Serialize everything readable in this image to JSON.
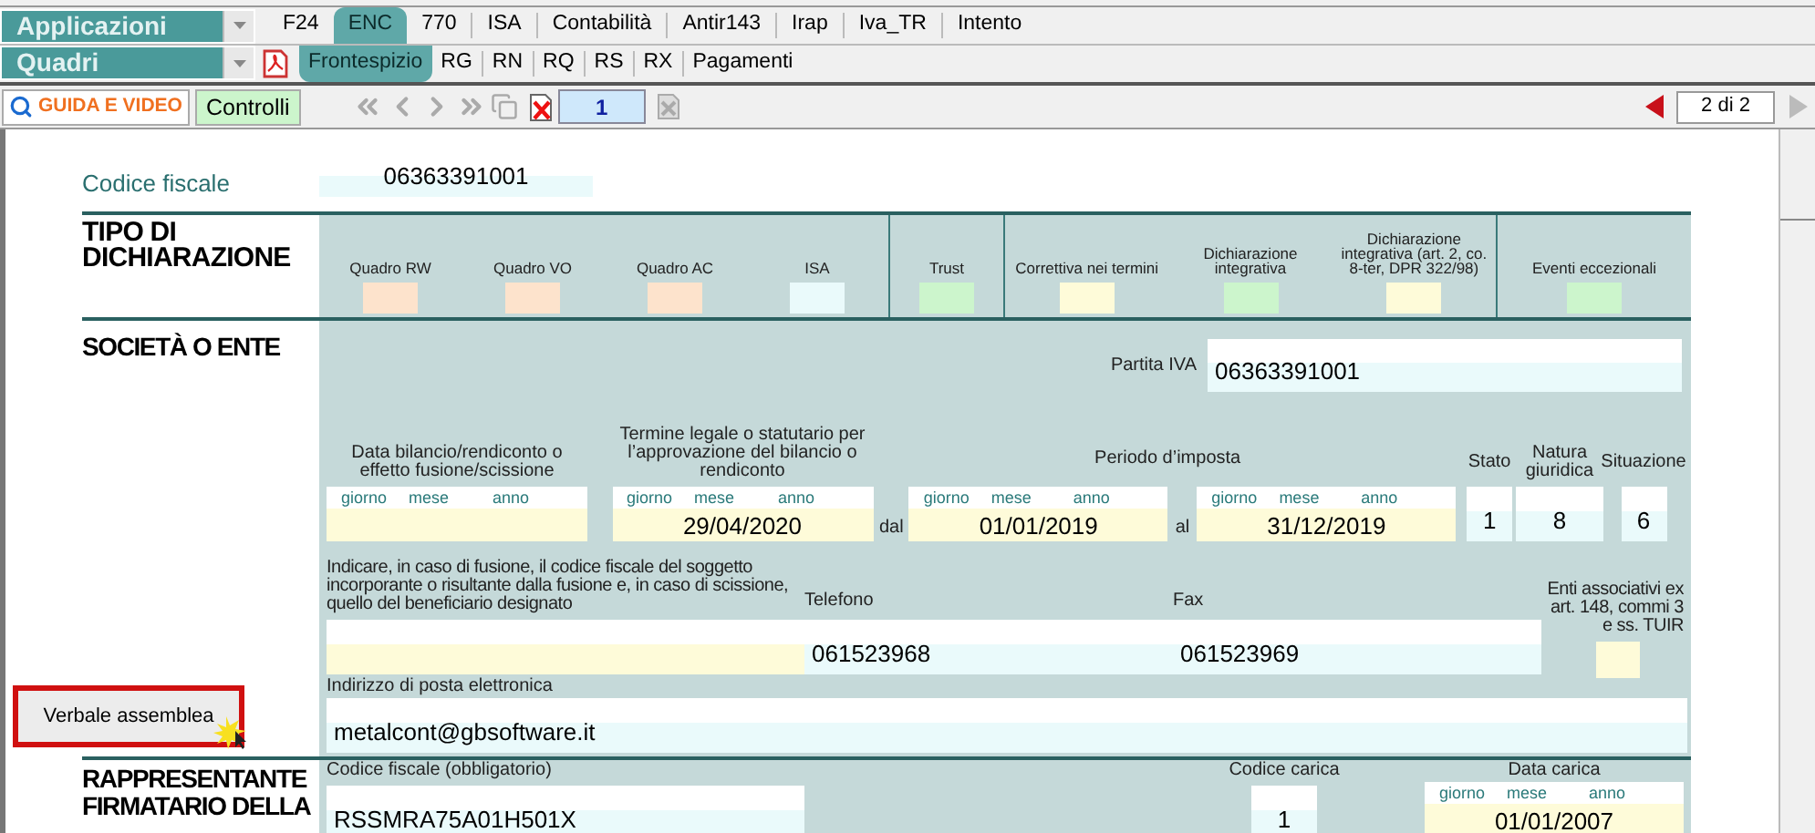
{
  "dropdowns": [
    {
      "value": "Applicazioni"
    },
    {
      "value": "Quadri"
    }
  ],
  "tabs": [
    {
      "label": "F24",
      "selected": false
    },
    {
      "label": "ENC",
      "selected": true
    },
    {
      "label": "770",
      "selected": false
    },
    {
      "label": "ISA",
      "selected": false
    },
    {
      "label": "Contabilità",
      "selected": false
    },
    {
      "label": "Antir143",
      "selected": false
    },
    {
      "label": "Irap",
      "selected": false
    },
    {
      "label": "Iva_TR",
      "selected": false
    },
    {
      "label": "Intento",
      "selected": false
    }
  ],
  "subtabs": [
    {
      "label": "Frontespizio",
      "selected": true
    },
    {
      "label": "RG",
      "selected": false
    },
    {
      "label": "RN",
      "selected": false
    },
    {
      "label": "RQ",
      "selected": false
    },
    {
      "label": "RS",
      "selected": false
    },
    {
      "label": "RX",
      "selected": false
    },
    {
      "label": "Pagamenti",
      "selected": false
    }
  ],
  "toolbar": {
    "guide_button": "GUIDA E VIDEO",
    "controls_button": "Controlli",
    "page_field": "1",
    "page_indicator": "2 di 2"
  },
  "codice_fiscale": {
    "label": "Codice fiscale",
    "value": "06363391001"
  },
  "tipo_dichiarazione": {
    "title": "TIPO DI DICHIARAZIONE",
    "groups": [
      [
        {
          "label": "Quadro RW",
          "color": "#fde3cc"
        },
        {
          "label": "Quadro VO",
          "color": "#fde3cc"
        },
        {
          "label": "Quadro AC",
          "color": "#fde3cc"
        },
        {
          "label": "ISA",
          "color": "#eafafb"
        }
      ],
      [
        {
          "label": "Trust",
          "color": "#ccf5cc"
        }
      ],
      [
        {
          "label": "Correttiva nei termini",
          "color": "#fefbd9"
        },
        {
          "label": "Dichiarazione integrativa",
          "color": "#ccf5cc"
        },
        {
          "label": "Dichiarazione integrativa (art. 2, co. 8-ter, DPR 322/98)",
          "color": "#fefbd9"
        }
      ],
      [
        {
          "label": "Eventi eccezionali",
          "color": "#ccf5cc"
        }
      ]
    ]
  },
  "societa": {
    "title": "SOCIETÀ O ENTE",
    "verbale_button": "Verbale assemblea",
    "partita_iva": {
      "label": "Partita IVA",
      "value": "06363391001"
    },
    "data_bilancio": {
      "label": "Data bilancio/rendiconto o effetto fusione/scissione",
      "parts": [
        "giorno",
        "mese",
        "anno"
      ]
    },
    "termine": {
      "label": "Termine legale o statutario per l’approvazione del bilancio o rendiconto",
      "parts": [
        "giorno",
        "mese",
        "anno"
      ],
      "value": "29/04/2020"
    },
    "periodo": {
      "label": "Periodo d’imposta",
      "from_label": "dal",
      "to_label": "al",
      "from": {
        "parts": [
          "giorno",
          "mese",
          "anno"
        ],
        "value": "01/01/2019"
      },
      "to": {
        "parts": [
          "giorno",
          "mese",
          "anno"
        ],
        "value": "31/12/2019"
      }
    },
    "stato": {
      "label": "Stato",
      "value": "1"
    },
    "natura": {
      "label": "Natura giuridica",
      "value": "8"
    },
    "situazione": {
      "label": "Situazione",
      "value": "6"
    },
    "cf_fusione": {
      "label": "Indicare, in caso di fusione, il codice fiscale del soggetto incorporante o risultante dalla fusione e, in caso di scissione, quello del beneficiario designato"
    },
    "telefono": {
      "label": "Telefono",
      "value": "061523968"
    },
    "fax": {
      "label": "Fax",
      "value": "061523969"
    },
    "enti": {
      "label": "Enti associativi ex art. 148, commi 3 e ss. TUIR",
      "color": "#fefbd9"
    },
    "email": {
      "label": "Indirizzo di posta elettronica",
      "value": "metalcont@gbsoftware.it"
    }
  },
  "rappresentante": {
    "title": "RAPPRESENTANTE FIRMATARIO DELLA",
    "codice_fiscale": {
      "label": "Codice fiscale (obbligatorio)",
      "value": "RSSMRA75A01H501X"
    },
    "codice_carica": {
      "label": "Codice carica",
      "value": "1"
    },
    "data_carica": {
      "label": "Data carica",
      "parts": [
        "giorno",
        "mese",
        "anno"
      ],
      "value": "01/01/2007"
    }
  }
}
